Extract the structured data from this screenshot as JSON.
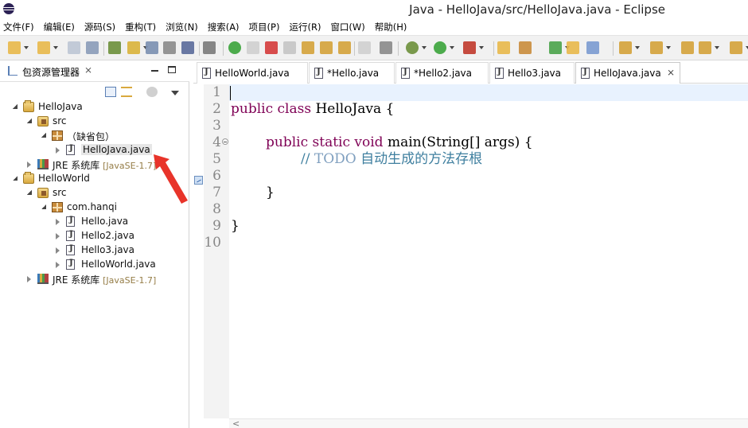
{
  "window": {
    "title": "Java - HelloJava/src/HelloJava.java - Eclipse"
  },
  "menu": {
    "items": [
      "文件(F)",
      "编辑(E)",
      "源码(S)",
      "重构(T)",
      "浏览(N)",
      "搜索(A)",
      "项目(P)",
      "运行(R)",
      "窗口(W)",
      "帮助(H)"
    ]
  },
  "toolbar": {
    "icons": [
      "new-icon",
      "new-wizard-icon",
      "save-icon",
      "save-all-icon",
      "debug-perspective-icon",
      "highlight-icon",
      "toggle-mark-icon",
      "show-whitespace-icon",
      "paragraph-icon",
      "skip-breakpoints-icon",
      "resume-icon",
      "suspend-icon",
      "terminate-icon",
      "disconnect-icon",
      "step-into-icon",
      "step-over-icon",
      "step-return-icon",
      "drop-to-frame-icon",
      "use-step-filters-icon",
      "debug-icon",
      "run-icon",
      "external-tools-icon",
      "new-java-project-icon",
      "new-package-icon",
      "new-class-icon",
      "open-type-icon",
      "open-task-icon",
      "search-icon",
      "next-annotation-icon",
      "previous-annotation-icon",
      "back-icon",
      "forward-icon"
    ]
  },
  "explorer": {
    "title": "包资源管理器",
    "close_glyph": "⨯",
    "tree": [
      {
        "label": "HelloJava",
        "decoration": "",
        "kind": "project",
        "depth": 0,
        "expanded": true
      },
      {
        "label": "src",
        "decoration": "",
        "kind": "srcfolder",
        "depth": 1,
        "expanded": true
      },
      {
        "label": "（缺省包）",
        "decoration": "",
        "kind": "package",
        "depth": 2,
        "expanded": true
      },
      {
        "label": "HelloJava.java",
        "decoration": "",
        "kind": "java",
        "depth": 3,
        "expanded": false,
        "selected": true
      },
      {
        "label": "JRE 系统库",
        "decoration": "[JavaSE-1.7]",
        "kind": "library",
        "depth": 1,
        "expanded": false
      },
      {
        "label": "HelloWorld",
        "decoration": "",
        "kind": "project",
        "depth": 0,
        "expanded": true
      },
      {
        "label": "src",
        "decoration": "",
        "kind": "srcfolder",
        "depth": 1,
        "expanded": true
      },
      {
        "label": "com.hanqi",
        "decoration": "",
        "kind": "package",
        "depth": 2,
        "expanded": true
      },
      {
        "label": "Hello.java",
        "decoration": "",
        "kind": "java",
        "depth": 3,
        "expanded": false
      },
      {
        "label": "Hello2.java",
        "decoration": "",
        "kind": "java",
        "depth": 3,
        "expanded": false
      },
      {
        "label": "Hello3.java",
        "decoration": "",
        "kind": "java",
        "depth": 3,
        "expanded": false
      },
      {
        "label": "HelloWorld.java",
        "decoration": "",
        "kind": "java",
        "depth": 3,
        "expanded": false
      },
      {
        "label": "JRE 系统库",
        "decoration": "[JavaSE-1.7]",
        "kind": "library",
        "depth": 1,
        "expanded": false
      }
    ]
  },
  "editor": {
    "tabs": [
      {
        "label": "HelloWorld.java",
        "active": false,
        "close": ""
      },
      {
        "label": "*Hello.java",
        "active": false,
        "close": ""
      },
      {
        "label": "*Hello2.java",
        "active": false,
        "close": ""
      },
      {
        "label": "Hello3.java",
        "active": false,
        "close": ""
      },
      {
        "label": "HelloJava.java",
        "active": true,
        "close": "⨯"
      }
    ],
    "line_numbers": [
      "1",
      "2",
      "3",
      "4",
      "5",
      "6",
      "7",
      "8",
      "9",
      "10"
    ],
    "code": {
      "l2_kw1": "public",
      "l2_kw2": "class",
      "l2_rest": " HelloJava {",
      "l4_kw1": "public",
      "l4_kw2": "static",
      "l4_kw3": "void",
      "l4_rest": " main(String[] args) {",
      "l5_comment": "// ",
      "l5_todo": "TODO",
      "l5_text": " 自动生成的方法存根",
      "l7": "}",
      "l9": "}"
    },
    "scroll_chevron": "<"
  },
  "colors": {
    "keyword": "#7f0055",
    "comment": "#3f7f9f",
    "todo": "#7f9fbf",
    "arrow": "#e8342a"
  }
}
